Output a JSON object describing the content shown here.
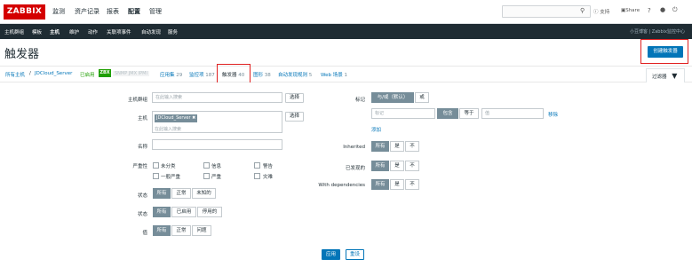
{
  "logo": "ZABBIX",
  "main_menu": [
    {
      "label": "监测",
      "active": false
    },
    {
      "label": "资产记录",
      "active": false
    },
    {
      "label": "报表",
      "active": false
    },
    {
      "label": "配置",
      "active": true
    },
    {
      "label": "管理",
      "active": false
    }
  ],
  "top_right": {
    "support": "支持",
    "share": "Share",
    "help": "?"
  },
  "sub_menu": [
    {
      "label": "主机群组",
      "active": false
    },
    {
      "label": "模板",
      "active": false
    },
    {
      "label": "主机",
      "active": true
    },
    {
      "label": "维护",
      "active": false
    },
    {
      "label": "动作",
      "active": false
    },
    {
      "label": "关联项事件",
      "active": false
    },
    {
      "label": "自动发现",
      "active": false
    },
    {
      "label": "服务",
      "active": false
    }
  ],
  "sub_right": "小豆博客 | Zabbix监控中心",
  "page_title": "触发器",
  "create_button": "创建触发器",
  "breadcrumb": {
    "all_hosts": "所有主机",
    "separator": "/",
    "host": "JDCloud_Server",
    "enabled": "已启用",
    "zbx": "ZBX",
    "other_ifaces": "SNMP JMX IPMI",
    "apps": {
      "label": "应用集",
      "count": "29"
    },
    "items": {
      "label": "监控项",
      "count": "187"
    },
    "triggers": {
      "label": "触发器",
      "count": "40"
    },
    "graphs": {
      "label": "图形",
      "count": "38"
    },
    "discovery": {
      "label": "自动发现规则",
      "count": "5"
    },
    "web": {
      "label": "Web 场景",
      "count": "1"
    }
  },
  "filter_tab": "过滤器",
  "filter": {
    "host_group": {
      "label": "主机群组",
      "placeholder": "在此输入搜索",
      "select": "选择"
    },
    "host": {
      "label": "主机",
      "tag": "JDCloud_Server",
      "placeholder": "在此输入搜索",
      "select": "选择"
    },
    "name": {
      "label": "名称",
      "value": ""
    },
    "severity": {
      "label": "严重性",
      "options": [
        "未分类",
        "信息",
        "警告",
        "一般严重",
        "严重",
        "灾难"
      ]
    },
    "state": {
      "label": "状态",
      "options": [
        "所有",
        "正常",
        "未知的"
      ],
      "selected": "所有"
    },
    "status": {
      "label": "状态",
      "options": [
        "所有",
        "已启用",
        "停用的"
      ],
      "selected": "所有"
    },
    "value": {
      "label": "值",
      "options": [
        "所有",
        "正常",
        "问题"
      ],
      "selected": "所有"
    },
    "tags": {
      "label": "标记",
      "operator_options": [
        "与/或（默认）",
        "或"
      ],
      "operator_selected": "与/或（默认）",
      "tag_placeholder": "标记",
      "match_options": [
        "包含",
        "等于"
      ],
      "match_selected": "包含",
      "value_placeholder": "值",
      "remove": "移除",
      "add": "添加"
    },
    "inherited": {
      "label": "Inherited",
      "options": [
        "所有",
        "是",
        "不"
      ],
      "selected": "所有"
    },
    "discovered": {
      "label": "已发现的",
      "options": [
        "所有",
        "是",
        "不"
      ],
      "selected": "所有"
    },
    "with_dependencies": {
      "label": "With dependencies",
      "options": [
        "所有",
        "是",
        "不"
      ],
      "selected": "所有"
    }
  },
  "buttons": {
    "apply": "应用",
    "reset": "重设"
  },
  "colors": {
    "brand_red": "#d40000",
    "primary_blue": "#0275b8",
    "dark_nav": "#1f2c33",
    "highlight_red": "#e02020",
    "enabled_green": "#1f9f00"
  }
}
